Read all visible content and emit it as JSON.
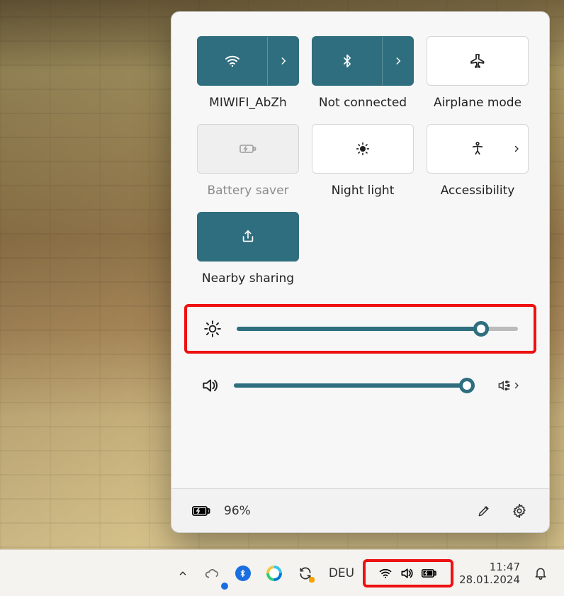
{
  "tiles": {
    "wifi": {
      "label": "MIWIFI_AbZh",
      "on": true,
      "split": true
    },
    "bluetooth": {
      "label": "Not connected",
      "on": true,
      "split": true
    },
    "airplane": {
      "label": "Airplane mode",
      "on": false,
      "split": false
    },
    "battery": {
      "label": "Battery saver",
      "on": false,
      "disabled": true
    },
    "night": {
      "label": "Night light",
      "on": false
    },
    "access": {
      "label": "Accessibility",
      "on": false,
      "chev": true
    },
    "nearby": {
      "label": "Nearby sharing",
      "on": true
    }
  },
  "sliders": {
    "brightness": {
      "percent": 87
    },
    "volume": {
      "percent": 97
    }
  },
  "footer": {
    "battery_percent": "96%"
  },
  "taskbar": {
    "language": "DEU",
    "time": "11:47",
    "date": "28.01.2024"
  },
  "colors": {
    "accent": "#2e6e7e",
    "highlight": "#e11"
  }
}
